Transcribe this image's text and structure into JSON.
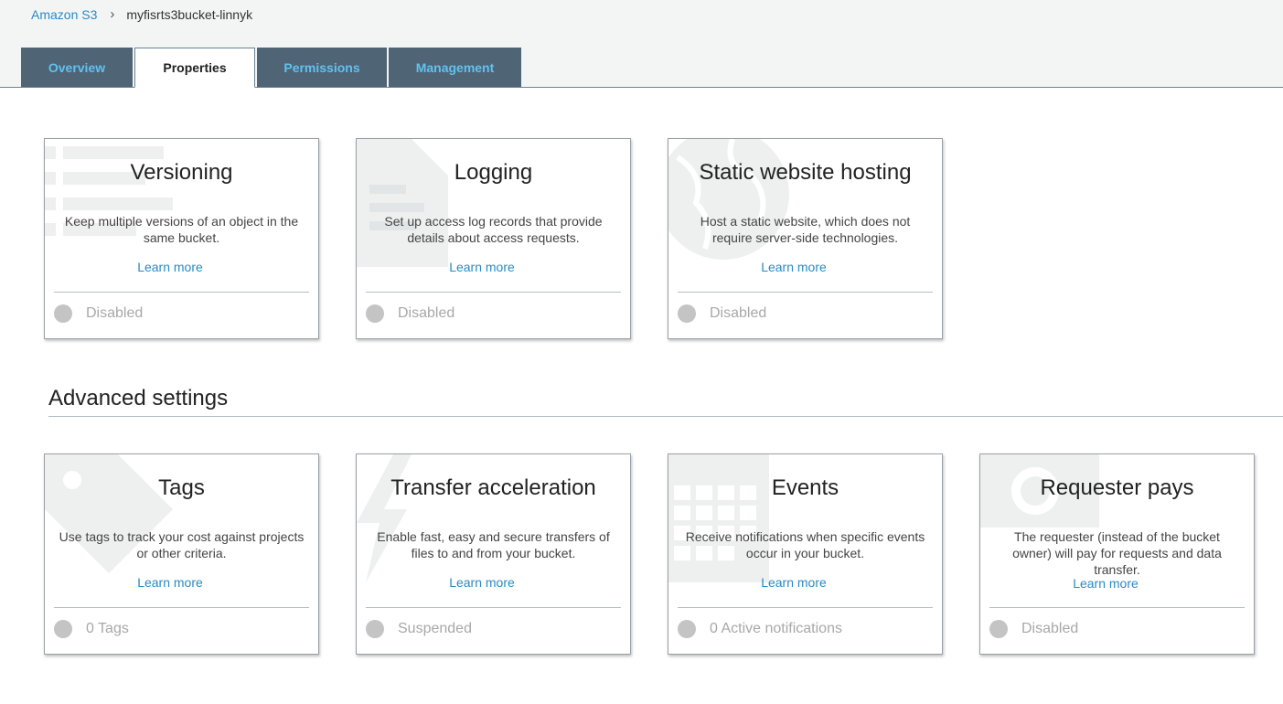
{
  "breadcrumb": {
    "root": "Amazon S3",
    "separator": "›",
    "current": "myfisrts3bucket-linnyk"
  },
  "tabs": [
    {
      "label": "Overview",
      "active": false
    },
    {
      "label": "Properties",
      "active": true
    },
    {
      "label": "Permissions",
      "active": false
    },
    {
      "label": "Management",
      "active": false
    }
  ],
  "properties": [
    {
      "title": "Versioning",
      "description": "Keep multiple versions of an object in the same bucket.",
      "link": "Learn more",
      "status": "Disabled",
      "icon": "list-icon"
    },
    {
      "title": "Logging",
      "description": "Set up access log records that provide details about access requests.",
      "link": "Learn more",
      "status": "Disabled",
      "icon": "document-icon"
    },
    {
      "title": "Static website hosting",
      "description": "Host a static website, which does not require server-side technologies.",
      "link": "Learn more",
      "status": "Disabled",
      "icon": "globe-icon"
    }
  ],
  "advanced": {
    "title": "Advanced settings",
    "cards": [
      {
        "title": "Tags",
        "description": "Use tags to track your cost against projects or other criteria.",
        "link": "Learn more",
        "status": "0 Tags",
        "icon": "tag-icon"
      },
      {
        "title": "Transfer acceleration",
        "description": "Enable fast, easy and secure transfers of files to and from your bucket.",
        "link": "Learn more",
        "status": "Suspended",
        "icon": "lightning-icon"
      },
      {
        "title": "Events",
        "description": "Receive notifications when specific events occur in your bucket.",
        "link": "Learn more",
        "status": "0 Active notifications",
        "icon": "calendar-icon"
      },
      {
        "title": "Requester pays",
        "description": "The requester (instead of the bucket owner) will pay for requests and data transfer.",
        "link": "Learn more",
        "status": "Disabled",
        "icon": "money-icon"
      }
    ]
  },
  "colors": {
    "tab_bg": "#4f6475",
    "tab_text": "#5fc2f0",
    "link": "#2b8ac2",
    "status_dot": "#c4c4c4",
    "watermark": "#eef0f0"
  }
}
